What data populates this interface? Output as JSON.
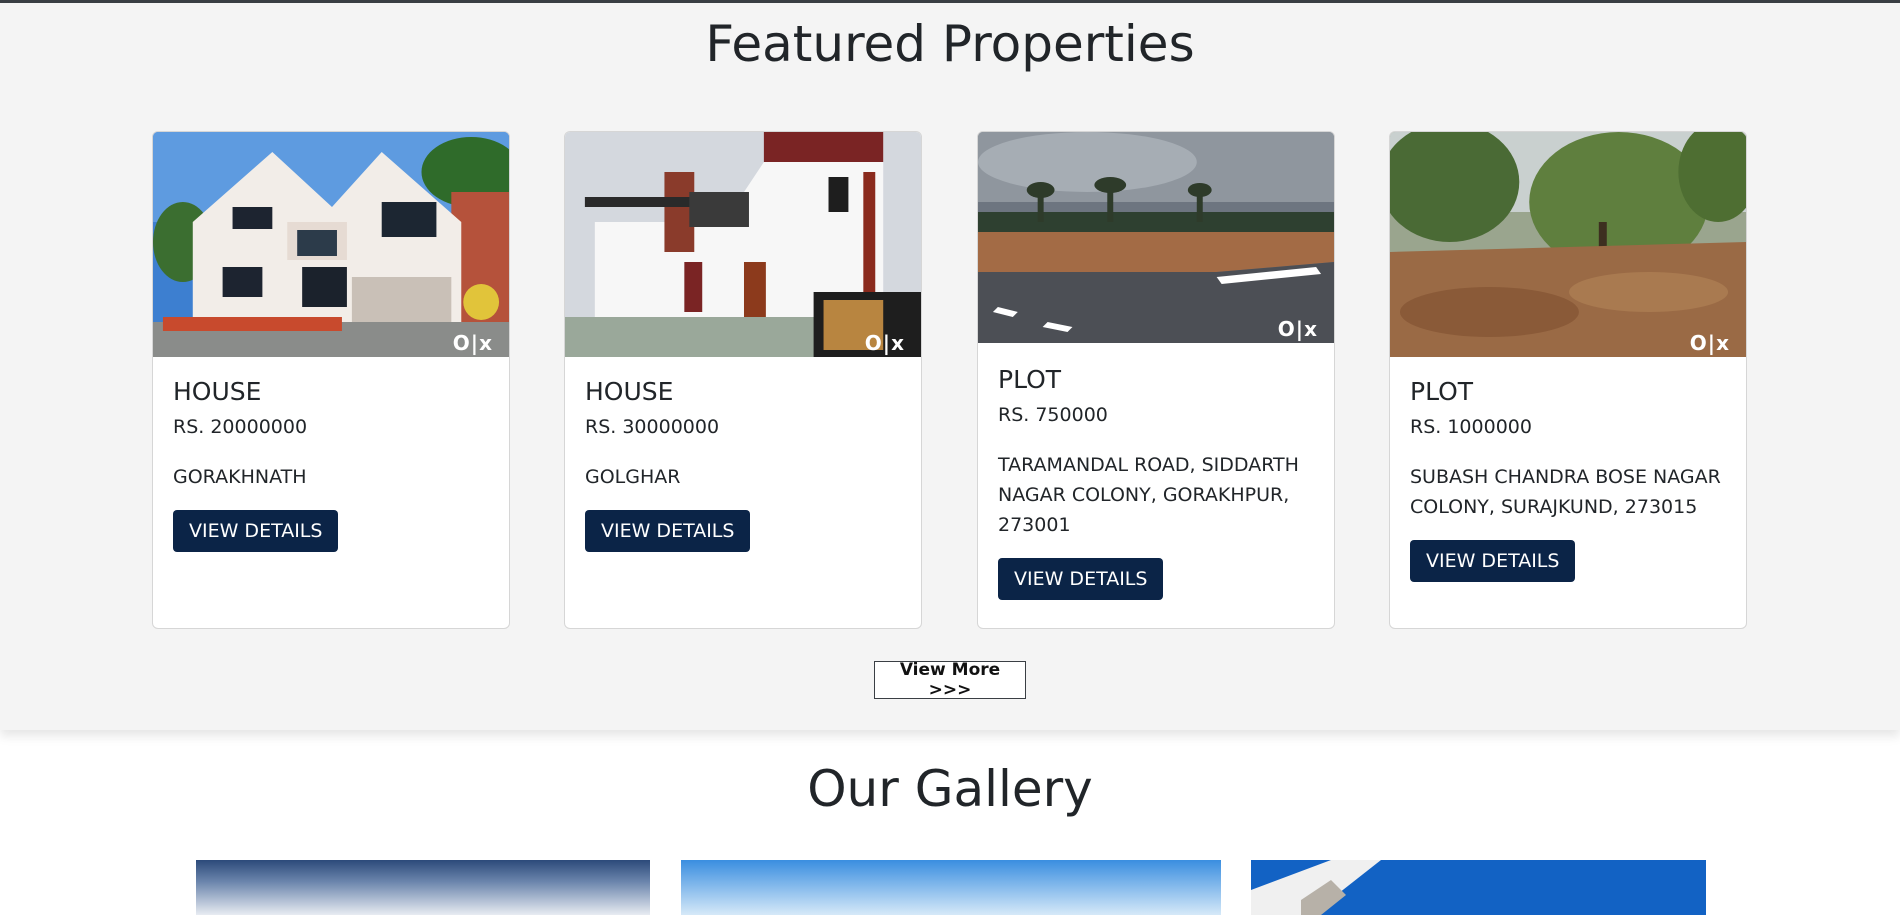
{
  "featured": {
    "title": "Featured Properties",
    "cards": [
      {
        "type": "HOUSE",
        "price": "RS. 20000000",
        "location": "GORAKHNATH",
        "button": "VIEW DETAILS",
        "watermark": "O|x"
      },
      {
        "type": "HOUSE",
        "price": "RS. 30000000",
        "location": "GOLGHAR",
        "button": "VIEW DETAILS",
        "watermark": "O|x"
      },
      {
        "type": "PLOT",
        "price": "RS. 750000",
        "location": "TARAMANDAL ROAD, SIDDARTH NAGAR COLONY, GORAKHPUR, 273001",
        "button": "VIEW DETAILS",
        "watermark": "O|x"
      },
      {
        "type": "PLOT",
        "price": "RS. 1000000",
        "location": "SUBASH CHANDRA BOSE NAGAR COLONY, SURAJKUND, 273015",
        "button": "VIEW DETAILS",
        "watermark": "O|x"
      }
    ],
    "view_more": "View More >>>"
  },
  "gallery": {
    "title": "Our Gallery"
  },
  "colors": {
    "button_bg": "#0b2447",
    "section_bg": "#f4f4f4"
  }
}
